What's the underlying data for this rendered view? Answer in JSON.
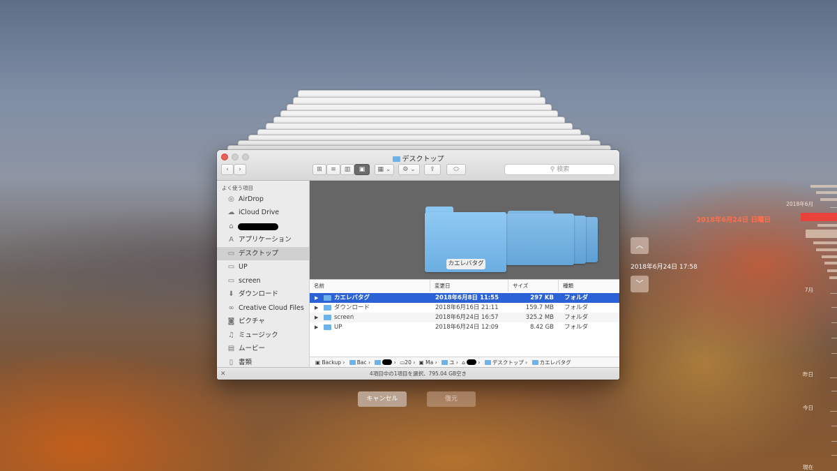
{
  "window": {
    "title": "デスクトップ",
    "search_placeholder": "検索",
    "view_buttons": [
      "icon-view-icon",
      "list-view-icon",
      "column-view-icon",
      "coverflow-view-icon"
    ]
  },
  "sidebar": {
    "header": "よく使う項目",
    "items": [
      {
        "label": "AirDrop",
        "icon": "airdrop-icon"
      },
      {
        "label": "iCloud Drive",
        "icon": "cloud-icon"
      },
      {
        "label": "",
        "icon": "home-icon",
        "redacted": true
      },
      {
        "label": "アプリケーション",
        "icon": "applications-icon"
      },
      {
        "label": "デスクトップ",
        "icon": "desktop-icon",
        "selected": true
      },
      {
        "label": "UP",
        "icon": "folder-icon"
      },
      {
        "label": "screen",
        "icon": "folder-icon"
      },
      {
        "label": "ダウンロード",
        "icon": "download-icon"
      },
      {
        "label": "Creative Cloud Files",
        "icon": "creative-cloud-icon"
      },
      {
        "label": "ピクチャ",
        "icon": "camera-icon"
      },
      {
        "label": "ミュージック",
        "icon": "music-icon"
      },
      {
        "label": "ムービー",
        "icon": "film-icon"
      },
      {
        "label": "書類",
        "icon": "document-icon"
      }
    ]
  },
  "preview": {
    "label": "カエレバタグ"
  },
  "table": {
    "headers": [
      "名前",
      "変更日",
      "サイズ",
      "種類"
    ],
    "rows": [
      {
        "name": "カエレバタグ",
        "date": "2018年6月8日 11:55",
        "size": "297 KB",
        "kind": "フォルダ",
        "selected": true
      },
      {
        "name": "ダウンロード",
        "date": "2018年6月16日 21:11",
        "size": "159.7 MB",
        "kind": "フォルダ"
      },
      {
        "name": "screen",
        "date": "2018年6月24日 16:57",
        "size": "325.2 MB",
        "kind": "フォルダ"
      },
      {
        "name": "UP",
        "date": "2018年6月24日 12:09",
        "size": "8.42 GB",
        "kind": "フォルダ"
      }
    ]
  },
  "pathbar": [
    "Backup",
    "Bac",
    "",
    "20",
    "Ma",
    "ユ",
    "",
    "デスクトップ",
    "カエレバタグ"
  ],
  "status": "4項目中の1項目を選択、795.04 GB空き",
  "buttons": {
    "cancel": "キャンセル",
    "restore": "復元"
  },
  "timemachine": {
    "current_snapshot": "2018年6月24日 17:58",
    "selected_date": "2018年6月24日 日曜日",
    "timeline_labels": [
      "2018年6月",
      "7月",
      "昨日",
      "今日",
      "現在"
    ]
  }
}
